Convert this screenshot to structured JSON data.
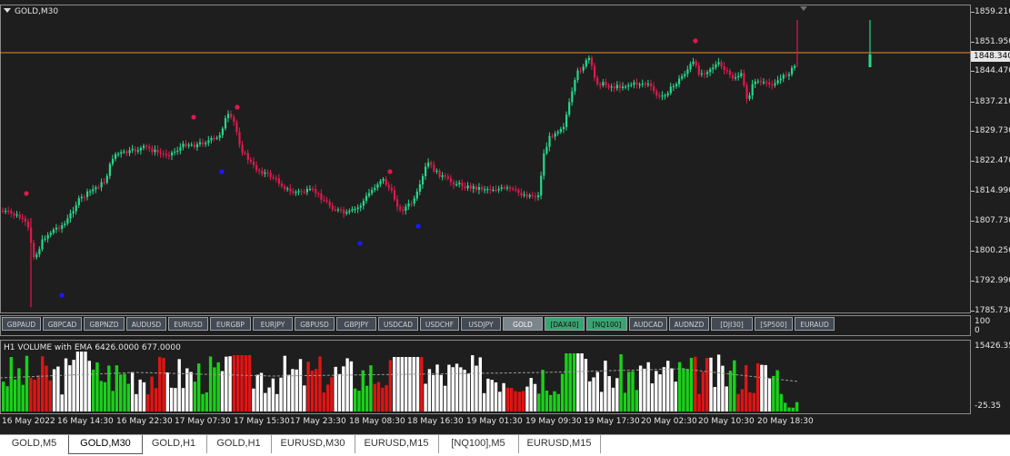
{
  "chart": {
    "title": "GOLD,M30",
    "current_price": "1848.340",
    "price_axis": [
      "1859.210",
      "1851.950",
      "1844.470",
      "1837.210",
      "1829.730",
      "1822.470",
      "1814.990",
      "1807.730",
      "1800.250",
      "1792.990",
      "1785.730"
    ],
    "time_axis": [
      "16 May 2022",
      "16 May 14:30",
      "16 May 22:30",
      "17 May 07:30",
      "17 May 15:30",
      "17 May 23:30",
      "18 May 08:30",
      "18 May 16:30",
      "19 May 01:30",
      "19 May 09:30",
      "19 May 17:30",
      "20 May 02:30",
      "20 May 10:30",
      "20 May 18:30"
    ],
    "colors": {
      "bull": "#26d98a",
      "bear": "#e0194f",
      "level_line": "#f28c28",
      "dot_red": "#e0194f",
      "dot_blue": "#1a1aff",
      "background": "#1e1e1e"
    }
  },
  "symbols": [
    {
      "label": "GBPAUD",
      "state": "normal"
    },
    {
      "label": "GBPCAD",
      "state": "normal"
    },
    {
      "label": "GBPNZD",
      "state": "normal"
    },
    {
      "label": "AUDUSD",
      "state": "normal"
    },
    {
      "label": "EURUSD",
      "state": "normal"
    },
    {
      "label": "EURGBP",
      "state": "normal"
    },
    {
      "label": "EURJPY",
      "state": "normal"
    },
    {
      "label": "GBPUSD",
      "state": "normal"
    },
    {
      "label": "GBPJPY",
      "state": "normal"
    },
    {
      "label": "USDCAD",
      "state": "normal"
    },
    {
      "label": "USDCHF",
      "state": "normal"
    },
    {
      "label": "USDJPY",
      "state": "normal"
    },
    {
      "label": "GOLD",
      "state": "active"
    },
    {
      "label": "[DAX40]",
      "state": "green"
    },
    {
      "label": "[NQ100]",
      "state": "green"
    },
    {
      "label": "AUDCAD",
      "state": "normal"
    },
    {
      "label": "AUDNZD",
      "state": "normal"
    },
    {
      "label": "[DJI30]",
      "state": "normal"
    },
    {
      "label": "[SP500]",
      "state": "normal"
    },
    {
      "label": "EURAUD",
      "state": "normal"
    }
  ],
  "button_pane_axis": [
    "100",
    "0"
  ],
  "volume": {
    "title": "H1 VOLUME with EMA 6426.0000 677.0000",
    "axis_top": "15426.35",
    "axis_bottom": "-25.35"
  },
  "tabs": [
    "GOLD,M5",
    "GOLD,M30",
    "GOLD,H1",
    "GOLD,H1",
    "EURUSD,M30",
    "EURUSD,M15",
    "[NQ100],M5",
    "EURUSD,M15"
  ],
  "active_tab": 1
}
